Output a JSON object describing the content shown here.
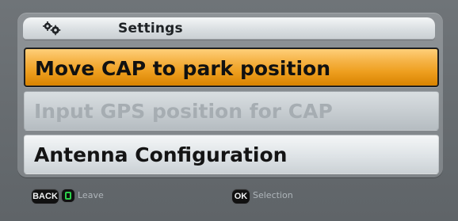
{
  "header": {
    "title": "Settings",
    "icon": "gear-icon"
  },
  "menu": {
    "items": [
      {
        "label": "Move CAP to park position",
        "state": "selected"
      },
      {
        "label": "Input GPS position for CAP",
        "state": "disabled"
      },
      {
        "label": "Antenna Configuration",
        "state": "normal"
      }
    ]
  },
  "footer": {
    "back_key": "BACK",
    "leave_label": "Leave",
    "ok_key": "OK",
    "selection_label": "Selection"
  },
  "colors": {
    "selected_orange": "#f0a22a",
    "panel_gray": "#868b8f",
    "disabled_text": "#a6adb2",
    "leave_green": "#2ccf4a"
  }
}
